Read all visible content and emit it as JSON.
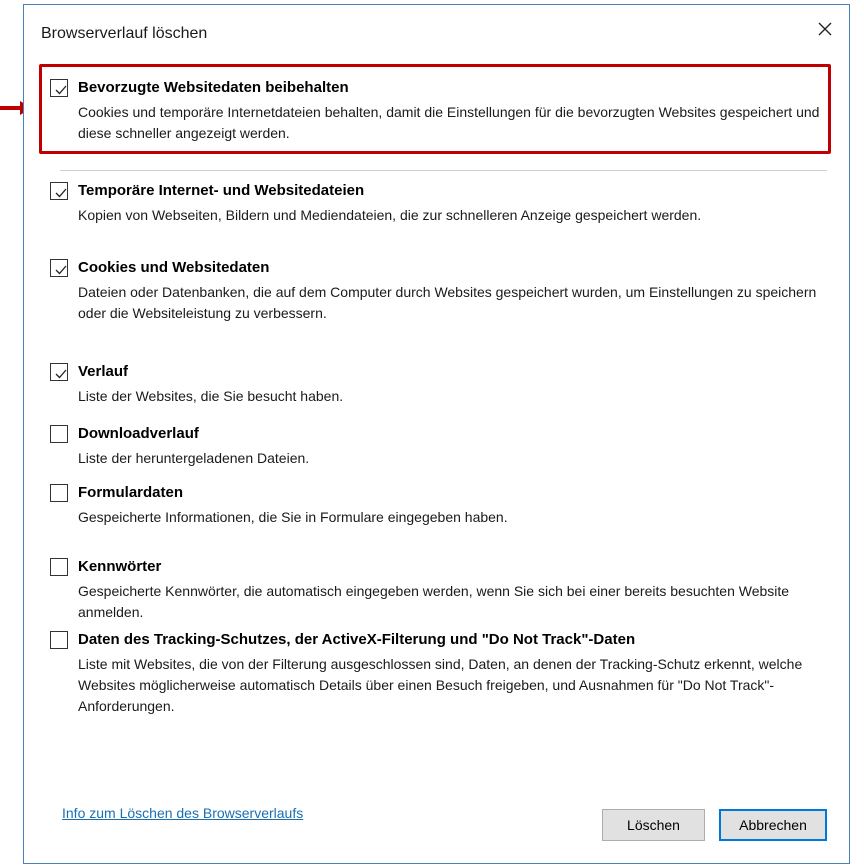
{
  "dialog": {
    "title": "Browserverlauf löschen"
  },
  "options": [
    {
      "title": "Bevorzugte Websitedaten beibehalten",
      "desc": "Cookies und temporäre Internetdateien behalten, damit die Einstellungen für die bevorzugten Websites gespeichert und diese schneller angezeigt werden.",
      "checked": true
    },
    {
      "title": "Temporäre Internet- und Websitedateien",
      "desc": "Kopien von Webseiten, Bildern und Mediendateien, die zur schnelleren Anzeige gespeichert werden.",
      "checked": true
    },
    {
      "title": "Cookies und Websitedaten",
      "desc": "Dateien oder Datenbanken, die auf dem Computer durch Websites gespeichert wurden, um Einstellungen zu speichern oder die Websiteleistung zu verbessern.",
      "checked": true
    },
    {
      "title": "Verlauf",
      "desc": "Liste der Websites, die Sie besucht haben.",
      "checked": true
    },
    {
      "title": "Downloadverlauf",
      "desc": "Liste der heruntergeladenen Dateien.",
      "checked": false
    },
    {
      "title": "Formulardaten",
      "desc": "Gespeicherte Informationen, die Sie in Formulare eingegeben haben.",
      "checked": false
    },
    {
      "title": "Kennwörter",
      "desc": "Gespeicherte Kennwörter, die automatisch eingegeben werden, wenn Sie sich bei einer bereits besuchten Website anmelden.",
      "checked": false
    },
    {
      "title": "Daten des Tracking-Schutzes, der ActiveX-Filterung und \"Do Not Track\"-Daten",
      "desc": "Liste mit Websites, die von der Filterung ausgeschlossen sind, Daten, an denen der Tracking-Schutz erkennt, welche Websites möglicherweise automatisch Details über einen Besuch freigeben, und Ausnahmen für \"Do Not Track\"-Anforderungen.",
      "checked": false
    }
  ],
  "footer": {
    "info_link": "Info zum Löschen des Browserverlaufs",
    "delete_label": "Löschen",
    "cancel_label": "Abbrechen"
  },
  "colors": {
    "highlight": "#c00000",
    "accent": "#0078d7",
    "link": "#1a6fb3"
  },
  "icons": {
    "close": "close-icon",
    "check": "check-icon",
    "arrow": "arrow-right-icon"
  }
}
